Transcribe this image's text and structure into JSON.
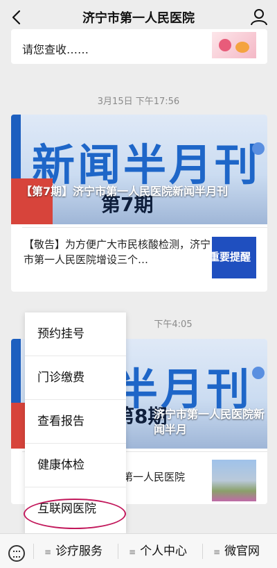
{
  "header": {
    "title": "济宁市第一人民医院"
  },
  "messages": [
    {
      "text": "请您查收……"
    },
    {
      "timestamp": "3月15日 下午17:56",
      "banner_text": "新闻半月刊",
      "banner_issue": "第7期",
      "banner_caption": "【第7期】济宁市第一人民医院新闻半月刊",
      "sub_title": "【敬告】为方便广大市民核酸检测，济宁市第一人民医院增设三个…",
      "sub_thumb_text": "重要提醒"
    },
    {
      "timestamp": "下午4:05",
      "banner_text": "半月刊",
      "banner_issue": "第8期",
      "banner_caption": "济宁市第一人民医院新闻半月",
      "sub_title": "市第一人民医院"
    }
  ],
  "popup_menu": {
    "items": [
      "预约挂号",
      "门诊缴费",
      "查看报告",
      "健康体检",
      "互联网医院"
    ],
    "highlighted": "互联网医院",
    "highlight_color": "#c2185b"
  },
  "bottom_menu": {
    "tabs": [
      "诊疗服务",
      "个人中心",
      "微官网"
    ]
  }
}
